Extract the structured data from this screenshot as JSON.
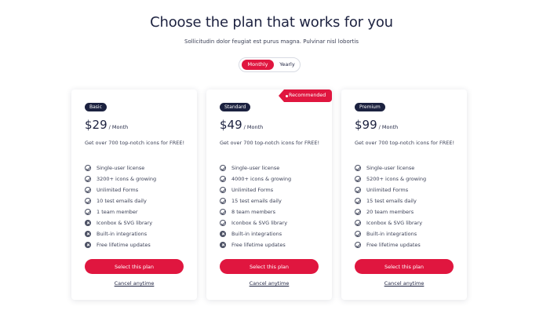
{
  "header": {
    "title": "Choose the plan that works for you",
    "subtitle": "Sollicitudin dolor feugiat est purus magna. Pulvinar nisl lobortis"
  },
  "billing_toggle": {
    "options": [
      "Monthly",
      "Yearly"
    ],
    "selected": "Monthly"
  },
  "recommended_label": "Recommended",
  "plans": [
    {
      "name": "Basic",
      "price": "$29",
      "period": "/ Month",
      "description": "Get over 700 top-notch icons for FREE!",
      "features": [
        {
          "label": "Single-user license",
          "included": true
        },
        {
          "label": "3200+ icons & growing",
          "included": true
        },
        {
          "label": "Unlimited Forms",
          "included": true
        },
        {
          "label": "10 test emails daily",
          "included": true
        },
        {
          "label": "1 team member",
          "included": true
        },
        {
          "label": "Iconbox & SVG library",
          "included": false
        },
        {
          "label": "Built-in integrations",
          "included": false
        },
        {
          "label": "Free lifetime updates",
          "included": false
        }
      ],
      "cta": "Select this plan",
      "cancel": "Cancel anytime"
    },
    {
      "name": "Standard",
      "price": "$49",
      "period": "/ Month",
      "description": "Get over 700 top-notch icons for FREE!",
      "features": [
        {
          "label": "Single-user license",
          "included": true
        },
        {
          "label": "4000+ icons & growing",
          "included": true
        },
        {
          "label": "Unlimited Forms",
          "included": true
        },
        {
          "label": "15 test emails daily",
          "included": true
        },
        {
          "label": "8 team members",
          "included": true
        },
        {
          "label": "Iconbox & SVG library",
          "included": true
        },
        {
          "label": "Built-in integrations",
          "included": false
        },
        {
          "label": "Free lifetime updates",
          "included": false
        }
      ],
      "cta": "Select this plan",
      "cancel": "Cancel anytime"
    },
    {
      "name": "Premium",
      "price": "$99",
      "period": "/ Month",
      "description": "Get over 700 top-notch icons for FREE!",
      "features": [
        {
          "label": "Single-user license",
          "included": true
        },
        {
          "label": "5200+ icons & growing",
          "included": true
        },
        {
          "label": "Unlimited Forms",
          "included": true
        },
        {
          "label": "15 test emails daily",
          "included": true
        },
        {
          "label": "20 team members",
          "included": true
        },
        {
          "label": "Iconbox & SVG library",
          "included": true
        },
        {
          "label": "Built-in integrations",
          "included": true
        },
        {
          "label": "Free lifetime updates",
          "included": true
        }
      ],
      "cta": "Select this plan",
      "cancel": "Cancel anytime"
    }
  ],
  "colors": {
    "accent": "#e0163f",
    "dark": "#1c2240"
  }
}
